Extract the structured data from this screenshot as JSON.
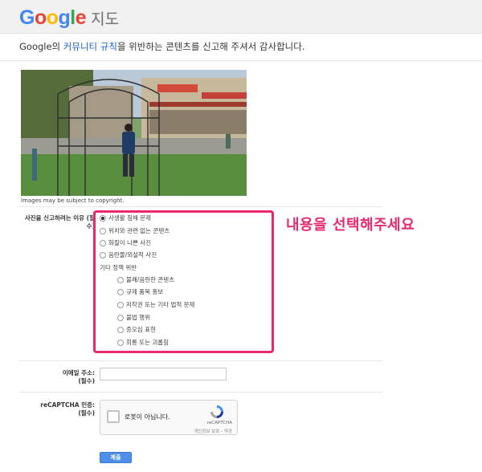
{
  "header": {
    "logo_letters": [
      {
        "ch": "G",
        "color": "#4285F4"
      },
      {
        "ch": "o",
        "color": "#EA4335"
      },
      {
        "ch": "o",
        "color": "#FBBC05"
      },
      {
        "ch": "g",
        "color": "#4285F4"
      },
      {
        "ch": "l",
        "color": "#34A853"
      },
      {
        "ch": "e",
        "color": "#EA4335"
      }
    ],
    "product_name": "지도"
  },
  "intro": {
    "prefix": "Google의 ",
    "link": "커뮤니티 규칙",
    "suffix": "을 위반하는 콘텐츠를 신고해 주셔서 감사합니다."
  },
  "photo": {
    "copyright": "Images may be subject to copyright."
  },
  "report": {
    "question_label": "사진을 신고하려는 이유 (필수)",
    "options": [
      {
        "label": "사생활 침해 문제",
        "checked": true
      },
      {
        "label": "위치와 관련 없는 콘텐츠",
        "checked": false
      },
      {
        "label": "화질이 나쁜 사진",
        "checked": false
      },
      {
        "label": "음란물/외설적 사진",
        "checked": false
      }
    ],
    "policy_group_label": "기타 정책 위반",
    "policy_options": [
      {
        "label": "불쾌/음란한 콘텐츠"
      },
      {
        "label": "규제 품목 홍보"
      },
      {
        "label": "저작권 또는 기타 법적 문제"
      },
      {
        "label": "불법 행위"
      },
      {
        "label": "증오심 표현"
      },
      {
        "label": "희롱 또는 괴롭힘"
      }
    ],
    "annotation": "내용을 선택해주세요",
    "accent_color": "#e8286f"
  },
  "email": {
    "label_line1": "이메일 주소:",
    "label_line2": "(필수)",
    "value": ""
  },
  "captcha": {
    "label_line1": "reCAPTCHA 인증:",
    "label_line2": "(필수)",
    "checkbox_text": "로봇이 아닙니다.",
    "brand": "reCAPTCHA",
    "links": "개인정보 보호 - 약관"
  },
  "submit_label": "제출"
}
